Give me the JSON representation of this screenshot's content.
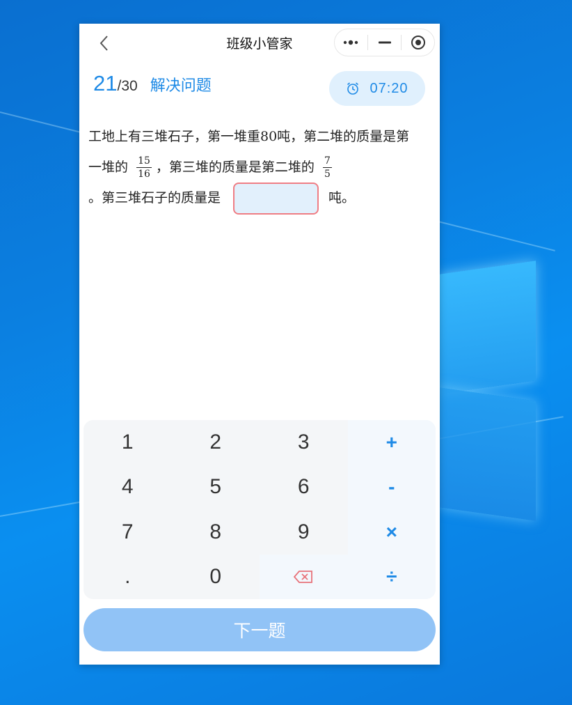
{
  "app": {
    "title": "班级小管家"
  },
  "header": {
    "current": "21",
    "total": "/30",
    "question_type": "解决问题",
    "timer": "07:20"
  },
  "question": {
    "part1": "工地上有三堆石子，第一堆重80吨，第二堆的质量是第一堆的",
    "frac1_num": "15",
    "frac1_den": "16",
    "part2": "，第三堆的质量是第二堆的",
    "frac2_num": "7",
    "frac2_den": "5",
    "part3": "。第三堆石子的质量是",
    "answer_value": "",
    "part4": "吨。"
  },
  "keypad": {
    "k1": "1",
    "k2": "2",
    "k3": "3",
    "plus": "+",
    "k4": "4",
    "k5": "5",
    "k6": "6",
    "minus": "-",
    "k7": "7",
    "k8": "8",
    "k9": "9",
    "times": "×",
    "dot": ".",
    "k0": "0",
    "divide": "÷"
  },
  "next_button": "下一题",
  "colors": {
    "accent": "#1e8ae6",
    "answer_border": "#ef7d84",
    "next_button": "#91c3f6"
  }
}
